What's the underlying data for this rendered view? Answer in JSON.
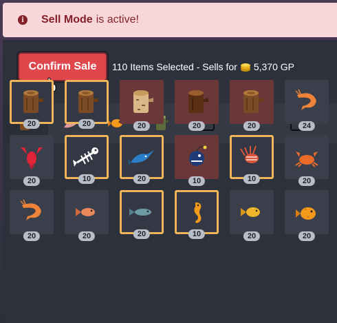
{
  "alert": {
    "bold": "Sell Mode",
    "rest": "is active!"
  },
  "sale": {
    "confirm_label": "Confirm Sale",
    "info_prefix": "110 Items Selected - Sells for",
    "amount": "5,370 GP"
  },
  "tabs": [
    {
      "icon": "log-icon",
      "active": true
    },
    {
      "icon": "fish-icon",
      "active": false
    },
    {
      "icon": "goldfish-icon",
      "active": false
    },
    {
      "icon": "mossy-log-icon",
      "active": false
    },
    {
      "icon": "empty-tab",
      "active": false
    },
    {
      "icon": "empty-tab",
      "active": false
    },
    {
      "icon": "empty-tab",
      "active": false
    }
  ],
  "items": [
    {
      "icon": "log-icon",
      "count": "20",
      "state": "selected"
    },
    {
      "icon": "log-icon",
      "count": "20",
      "state": "selected"
    },
    {
      "icon": "birch-log-icon",
      "count": "20",
      "state": "unsellable"
    },
    {
      "icon": "dark-log-icon",
      "count": "20",
      "state": "unsellable"
    },
    {
      "icon": "log-icon",
      "count": "20",
      "state": "unsellable"
    },
    {
      "icon": "shrimp-icon",
      "count": "24",
      "state": "normal"
    },
    {
      "icon": "lobster-icon",
      "count": "20",
      "state": "normal"
    },
    {
      "icon": "fish-bones-icon",
      "count": "10",
      "state": "selected"
    },
    {
      "icon": "swordfish-icon",
      "count": "20",
      "state": "selected"
    },
    {
      "icon": "anglerfish-icon",
      "count": "10",
      "state": "unsellable"
    },
    {
      "icon": "lionfish-icon",
      "count": "10",
      "state": "selected"
    },
    {
      "icon": "crab-icon",
      "count": "20",
      "state": "normal"
    },
    {
      "icon": "shrimp-icon",
      "count": "20",
      "state": "normal"
    },
    {
      "icon": "red-fish-icon",
      "count": "20",
      "state": "normal"
    },
    {
      "icon": "trout-icon",
      "count": "20",
      "state": "selected"
    },
    {
      "icon": "seahorse-icon",
      "count": "10",
      "state": "selected"
    },
    {
      "icon": "goldfish-icon",
      "count": "20",
      "state": "normal"
    },
    {
      "icon": "pufferfish-icon",
      "count": "20",
      "state": "normal"
    }
  ],
  "colors": {
    "selected": "#f0b45a",
    "unsellable": "#6a3838",
    "confirm": "#e0474c"
  }
}
